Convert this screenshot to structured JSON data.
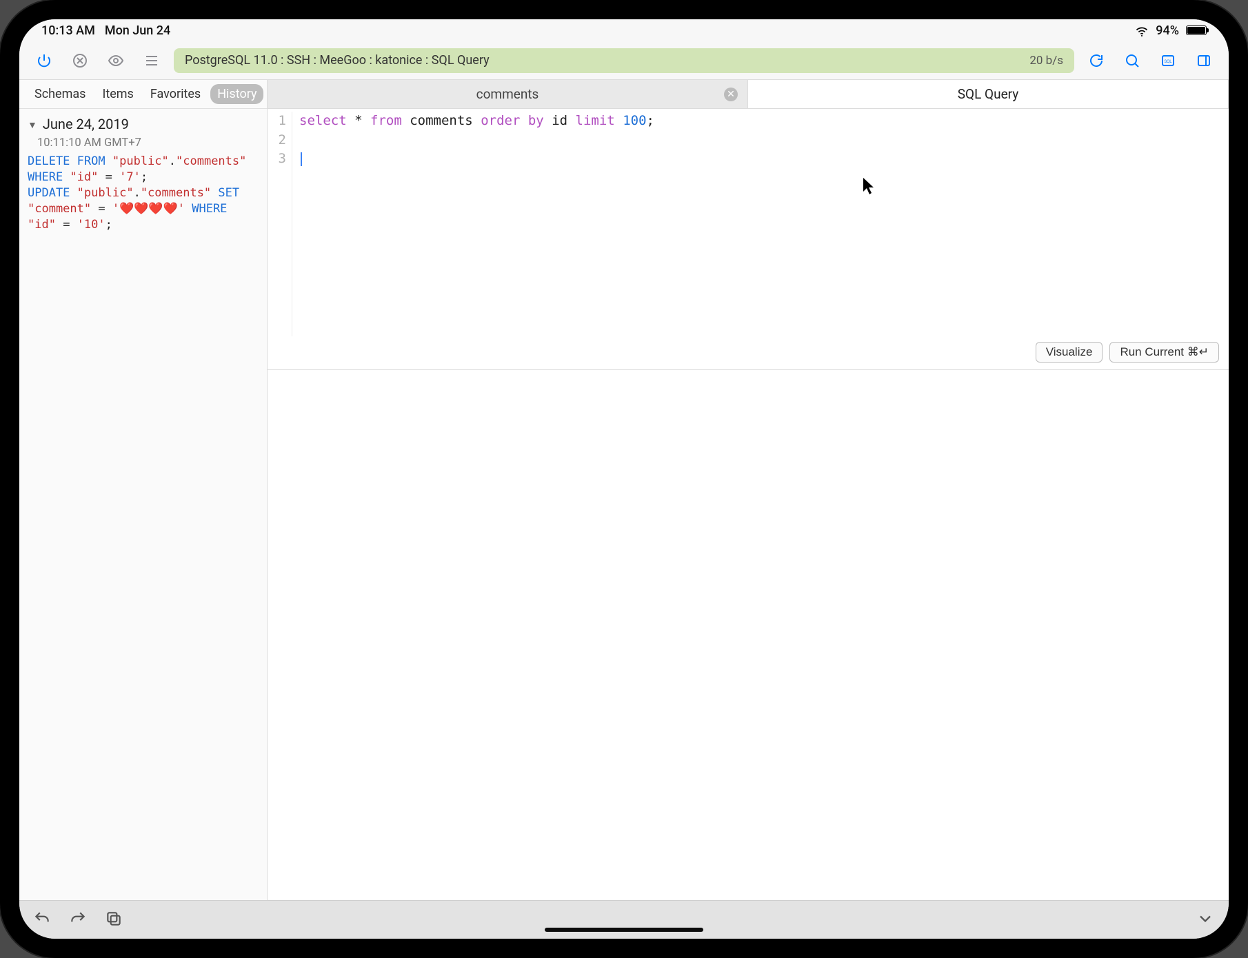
{
  "status_bar": {
    "time": "10:13 AM",
    "date": "Mon Jun 24",
    "battery_pct": "94%"
  },
  "toolbar": {
    "connection_label": "PostgreSQL 11.0 : SSH : MeeGoo : katonice : SQL Query",
    "rate": "20 b/s"
  },
  "sidebar": {
    "tabs": {
      "schemas": "Schemas",
      "items": "Items",
      "favorites": "Favorites",
      "history": "History"
    },
    "active_tab": "history",
    "date_group": "June 24, 2019",
    "timestamp": "10:11:10 AM GMT+7",
    "history_sql_tokens": [
      {
        "t": "DELETE",
        "c": "k-blue"
      },
      {
        "t": " ",
        "c": "k-plain"
      },
      {
        "t": "FROM",
        "c": "k-blue"
      },
      {
        "t": " ",
        "c": "k-plain"
      },
      {
        "t": "\"public\"",
        "c": "k-red"
      },
      {
        "t": ".",
        "c": "k-plain"
      },
      {
        "t": "\"comments\"",
        "c": "k-red"
      },
      {
        "t": "\n",
        "c": "k-plain"
      },
      {
        "t": "WHERE",
        "c": "k-blue"
      },
      {
        "t": " ",
        "c": "k-plain"
      },
      {
        "t": "\"id\"",
        "c": "k-red"
      },
      {
        "t": " = ",
        "c": "k-plain"
      },
      {
        "t": "'7'",
        "c": "k-red"
      },
      {
        "t": ";",
        "c": "k-plain"
      },
      {
        "t": "\n",
        "c": "k-plain"
      },
      {
        "t": "UPDATE",
        "c": "k-blue"
      },
      {
        "t": " ",
        "c": "k-plain"
      },
      {
        "t": "\"public\"",
        "c": "k-red"
      },
      {
        "t": ".",
        "c": "k-plain"
      },
      {
        "t": "\"comments\"",
        "c": "k-red"
      },
      {
        "t": " ",
        "c": "k-plain"
      },
      {
        "t": "SET",
        "c": "k-blue"
      },
      {
        "t": "\n",
        "c": "k-plain"
      },
      {
        "t": "\"comment\"",
        "c": "k-red"
      },
      {
        "t": " = ",
        "c": "k-plain"
      },
      {
        "t": "'❤️❤️❤️❤️'",
        "c": "k-red"
      },
      {
        "t": " ",
        "c": "k-plain"
      },
      {
        "t": "WHERE",
        "c": "k-blue"
      },
      {
        "t": "\n",
        "c": "k-plain"
      },
      {
        "t": "\"id\"",
        "c": "k-red"
      },
      {
        "t": " = ",
        "c": "k-plain"
      },
      {
        "t": "'10'",
        "c": "k-red"
      },
      {
        "t": ";",
        "c": "k-plain"
      }
    ]
  },
  "tabs": {
    "comments": "comments",
    "sql_query": "SQL Query"
  },
  "editor": {
    "gutter": [
      "1",
      "2",
      "3"
    ],
    "tokens": [
      {
        "t": "select",
        "c": "kw"
      },
      {
        "t": " ",
        "c": "pun"
      },
      {
        "t": "*",
        "c": "ident"
      },
      {
        "t": " ",
        "c": "pun"
      },
      {
        "t": "from",
        "c": "kw"
      },
      {
        "t": " ",
        "c": "pun"
      },
      {
        "t": "comments",
        "c": "ident"
      },
      {
        "t": " ",
        "c": "pun"
      },
      {
        "t": "order",
        "c": "kw"
      },
      {
        "t": " ",
        "c": "pun"
      },
      {
        "t": "by",
        "c": "kw"
      },
      {
        "t": " ",
        "c": "pun"
      },
      {
        "t": "id",
        "c": "ident"
      },
      {
        "t": " ",
        "c": "pun"
      },
      {
        "t": "limit",
        "c": "kw"
      },
      {
        "t": " ",
        "c": "pun"
      },
      {
        "t": "100",
        "c": "num"
      },
      {
        "t": ";",
        "c": "pun"
      }
    ],
    "buttons": {
      "visualize": "Visualize",
      "run_current": "Run Current ⌘↵"
    }
  }
}
